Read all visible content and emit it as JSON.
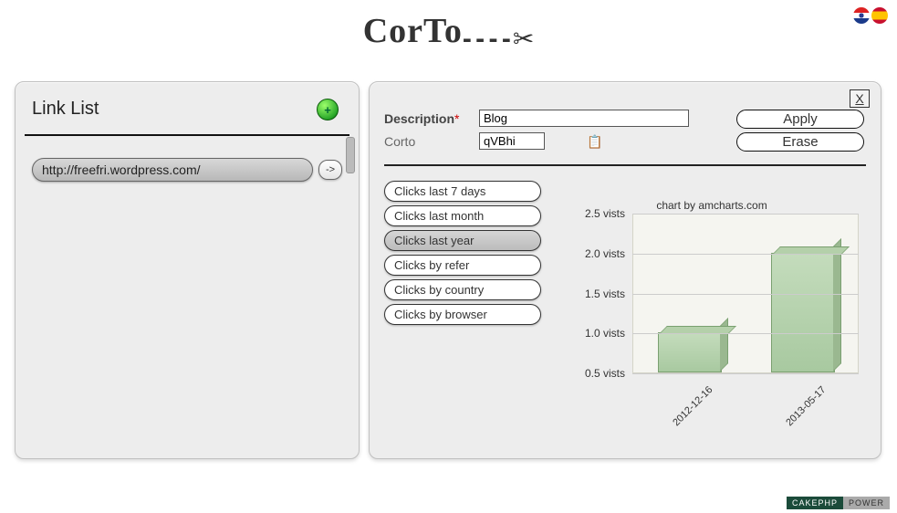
{
  "header": {
    "logo_text": "CorTo",
    "flags": [
      "en",
      "es"
    ]
  },
  "left": {
    "title": "Link List",
    "add_icon_label": "+",
    "links": [
      {
        "url": "http://freefri.wordpress.com/",
        "go_label": "->"
      }
    ]
  },
  "right": {
    "close_label": "X",
    "form": {
      "description_label": "Description",
      "description_value": "Blog",
      "corto_label": "Corto",
      "corto_value": "qVBhi"
    },
    "actions": {
      "apply": "Apply",
      "erase": "Erase"
    },
    "chart_tabs": [
      "Clicks last 7 days",
      "Clicks last month",
      "Clicks last year",
      "Clicks by refer",
      "Clicks by country",
      "Clicks by browser"
    ],
    "chart_tab_active_index": 2,
    "chart_credit": "chart by amcharts.com"
  },
  "chart_data": {
    "type": "bar",
    "categories": [
      "2012-12-16",
      "2013-05-17"
    ],
    "values": [
      1.0,
      2.0
    ],
    "ylabel_suffix": " vists",
    "yticks": [
      0.5,
      1.0,
      1.5,
      2.0,
      2.5
    ],
    "ylim": [
      0.5,
      2.5
    ]
  },
  "footer": {
    "badge_left": "CAKEPHP",
    "badge_right": "POWER"
  }
}
